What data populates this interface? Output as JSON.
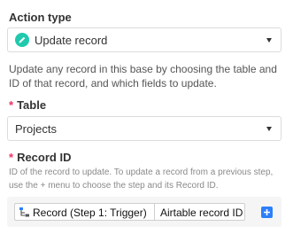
{
  "action_type": {
    "label": "Action type",
    "selected": "Update record",
    "icon": "pencil-icon",
    "icon_color": "#20c9ad",
    "description": "Update any record in this base by choosing the table and ID of that record, and which fields to update."
  },
  "table": {
    "required_mark": "*",
    "label": "Table",
    "selected": "Projects"
  },
  "record_id": {
    "required_mark": "*",
    "label": "Record ID",
    "help": "ID of the record to update. To update a record from a previous step, use the + menu to choose the step and its Record ID.",
    "token_source": "Record (Step 1: Trigger)",
    "token_field": "Airtable record ID",
    "add_icon": "plus-icon",
    "accent_color": "#2d7ff9"
  },
  "colors": {
    "required": "#ef3061"
  }
}
